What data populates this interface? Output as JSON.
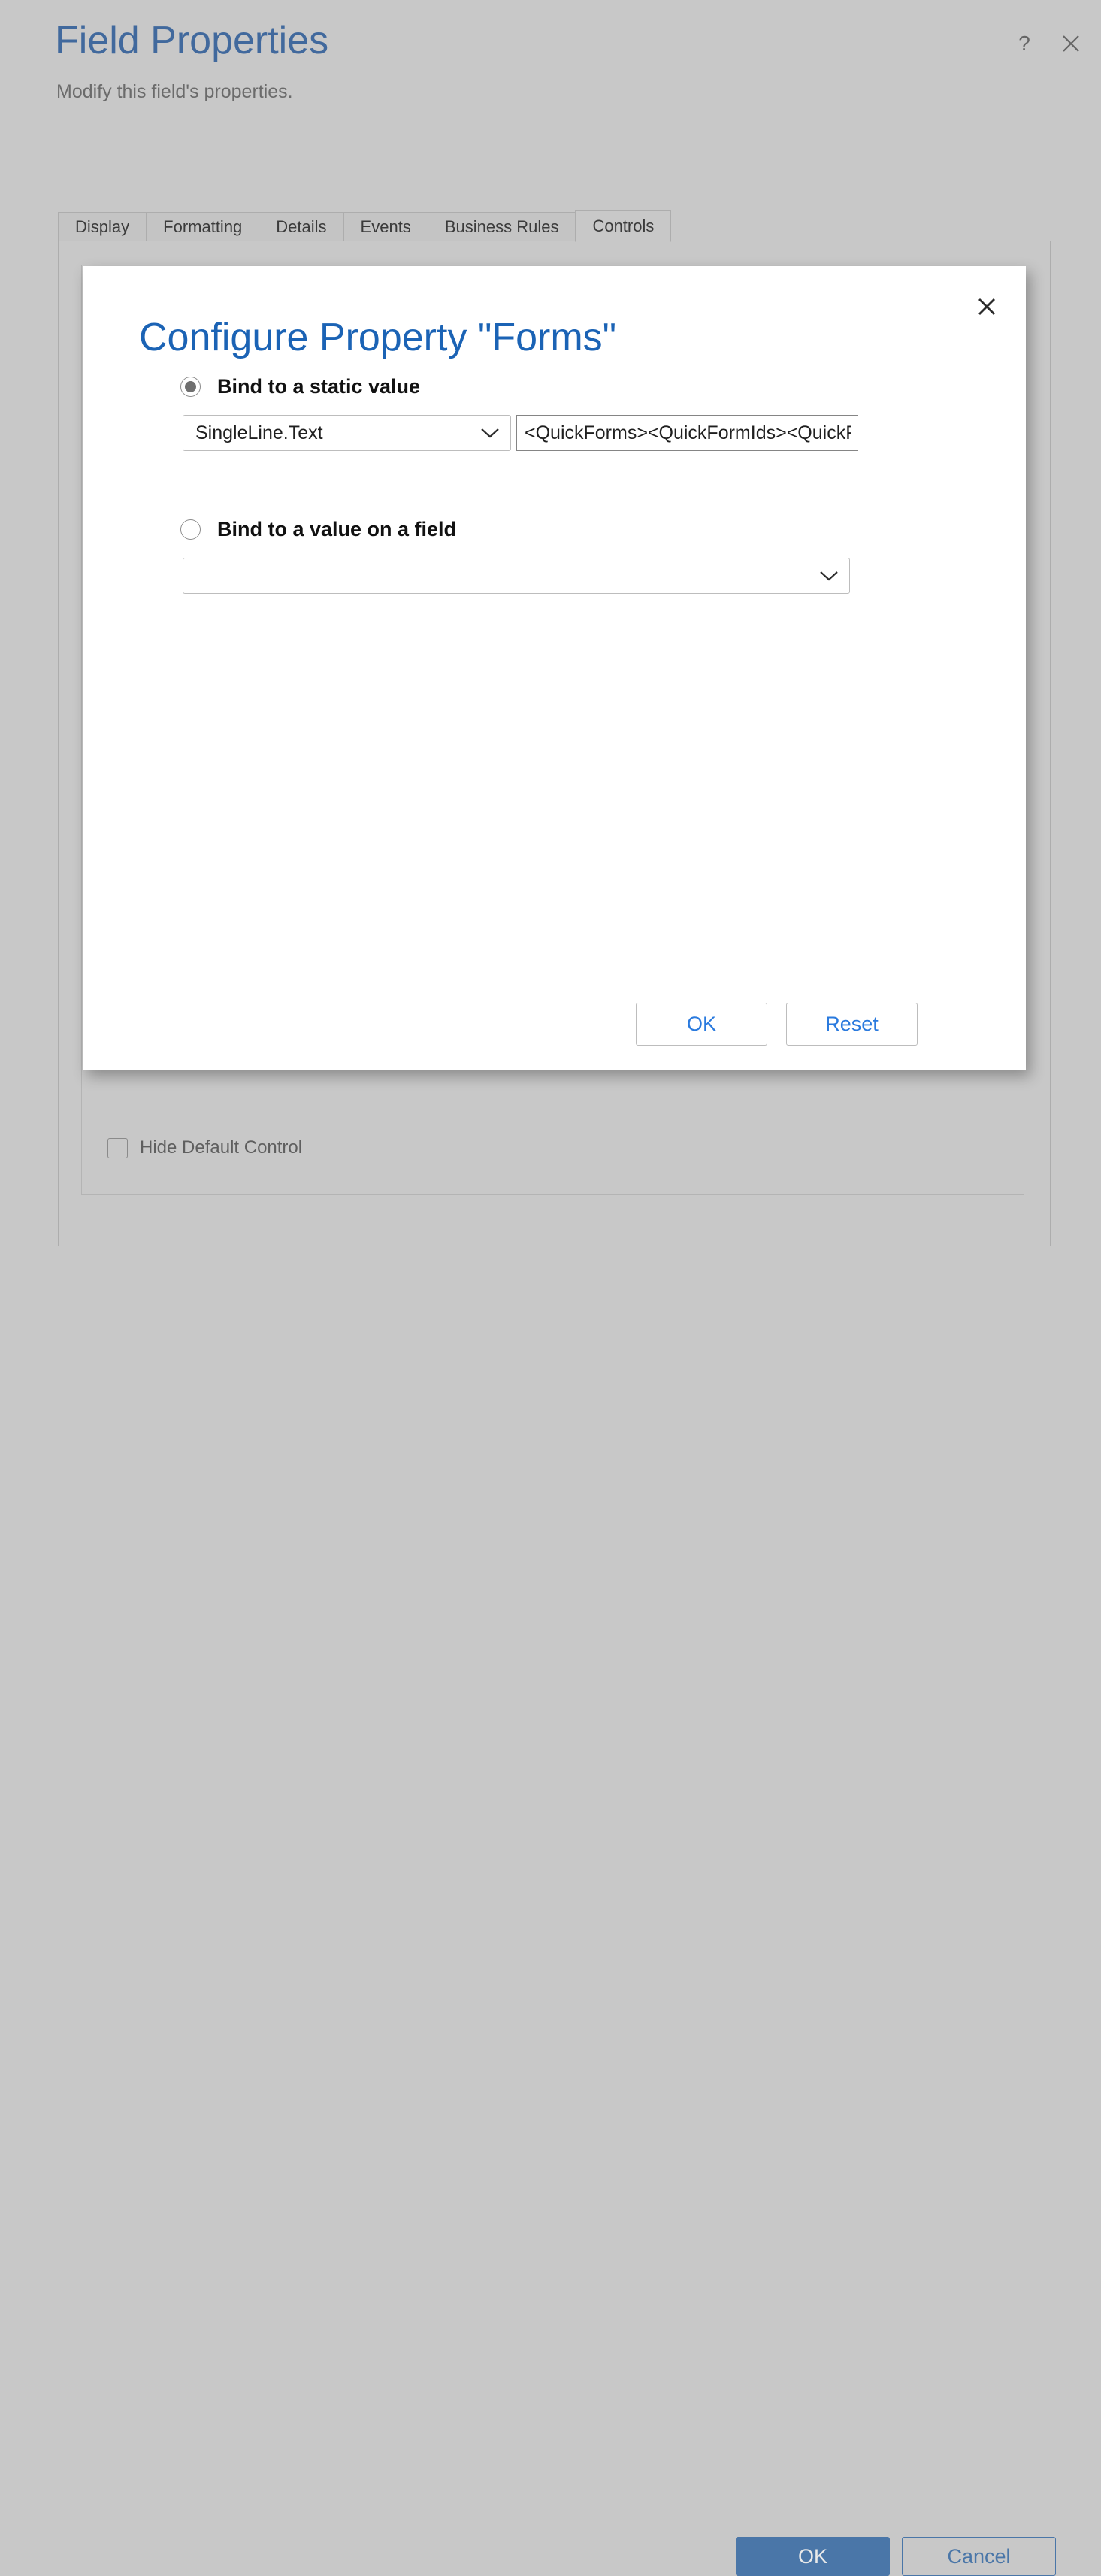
{
  "header": {
    "title": "Field Properties",
    "subtitle": "Modify this field's properties.",
    "help_icon": "question-mark-icon",
    "close_icon": "close-icon"
  },
  "tabs": [
    {
      "label": "Display",
      "active": false
    },
    {
      "label": "Formatting",
      "active": false
    },
    {
      "label": "Details",
      "active": false
    },
    {
      "label": "Events",
      "active": false
    },
    {
      "label": "Business Rules",
      "active": false
    },
    {
      "label": "Controls",
      "active": true
    }
  ],
  "controls_tab": {
    "hide_default_control": {
      "label": "Hide Default Control",
      "checked": false
    }
  },
  "modal": {
    "title": "Configure Property \"Forms\"",
    "close_icon": "close-icon",
    "options": [
      {
        "key": "static",
        "label": "Bind to a static value",
        "selected": true
      },
      {
        "key": "field",
        "label": "Bind to a value on a field",
        "selected": false
      }
    ],
    "static_type_select": {
      "value": "SingleLine.Text",
      "chevron_icon": "chevron-down-icon"
    },
    "static_value_input": {
      "value": "<QuickForms><QuickFormIds><QuickFormId>",
      "placeholder": ""
    },
    "field_select": {
      "value": "",
      "placeholder": "",
      "chevron_icon": "chevron-down-icon"
    },
    "buttons": {
      "ok": "OK",
      "reset": "Reset"
    }
  },
  "footer": {
    "ok": "OK",
    "cancel": "Cancel"
  },
  "colors": {
    "page_background": "#c8c8c8",
    "title_blue": "#41699d",
    "modal_title_blue": "#1b63b5",
    "link_blue": "#2a7ade",
    "primary_button": "#4a76a8"
  }
}
